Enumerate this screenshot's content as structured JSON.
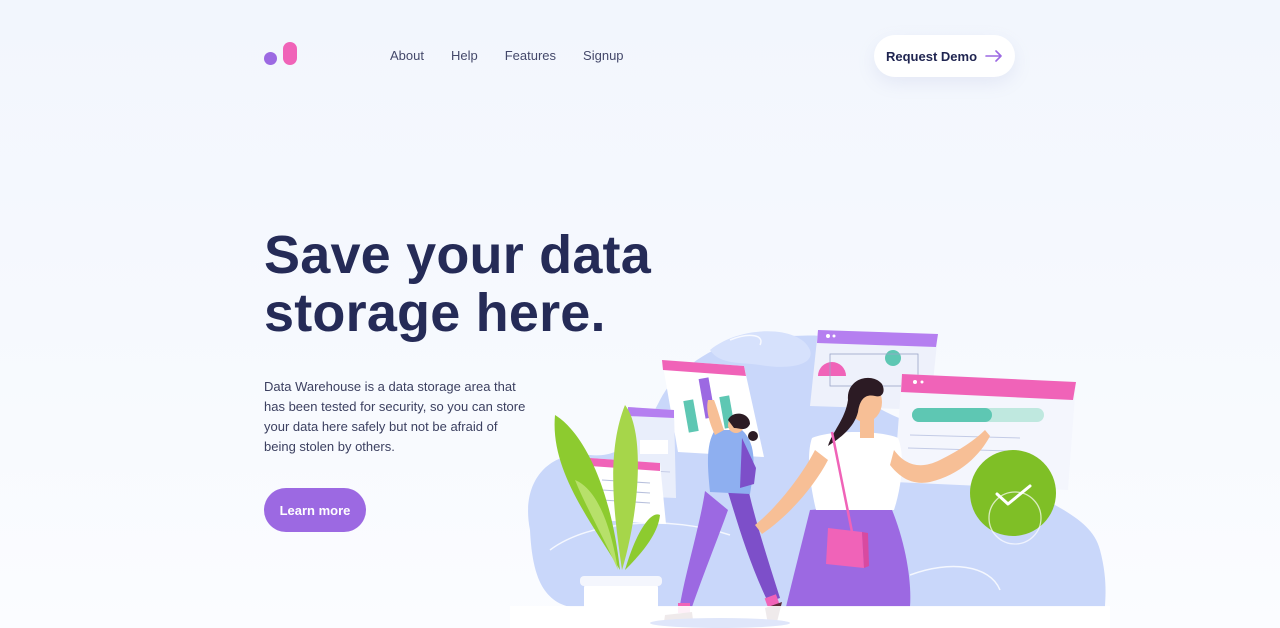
{
  "header": {
    "nav": [
      {
        "label": "About"
      },
      {
        "label": "Help"
      },
      {
        "label": "Features"
      },
      {
        "label": "Signup"
      }
    ],
    "cta_label": "Request Demo"
  },
  "hero": {
    "title_line1": "Save your data",
    "title_line2": "storage here.",
    "description": "Data Warehouse is a data storage area that has been tested for security, so you can store your data here safely but not be afraid of being stolen by others.",
    "button_label": "Learn more"
  },
  "colors": {
    "primary_purple": "#9c69e2",
    "accent_pink": "#f063b8",
    "heading_navy": "#252b57",
    "success_green": "#7fbf26",
    "teal": "#5ec7b3"
  },
  "icons": {
    "cta_arrow": "arrow-right-icon",
    "checkmark": "check-icon"
  }
}
